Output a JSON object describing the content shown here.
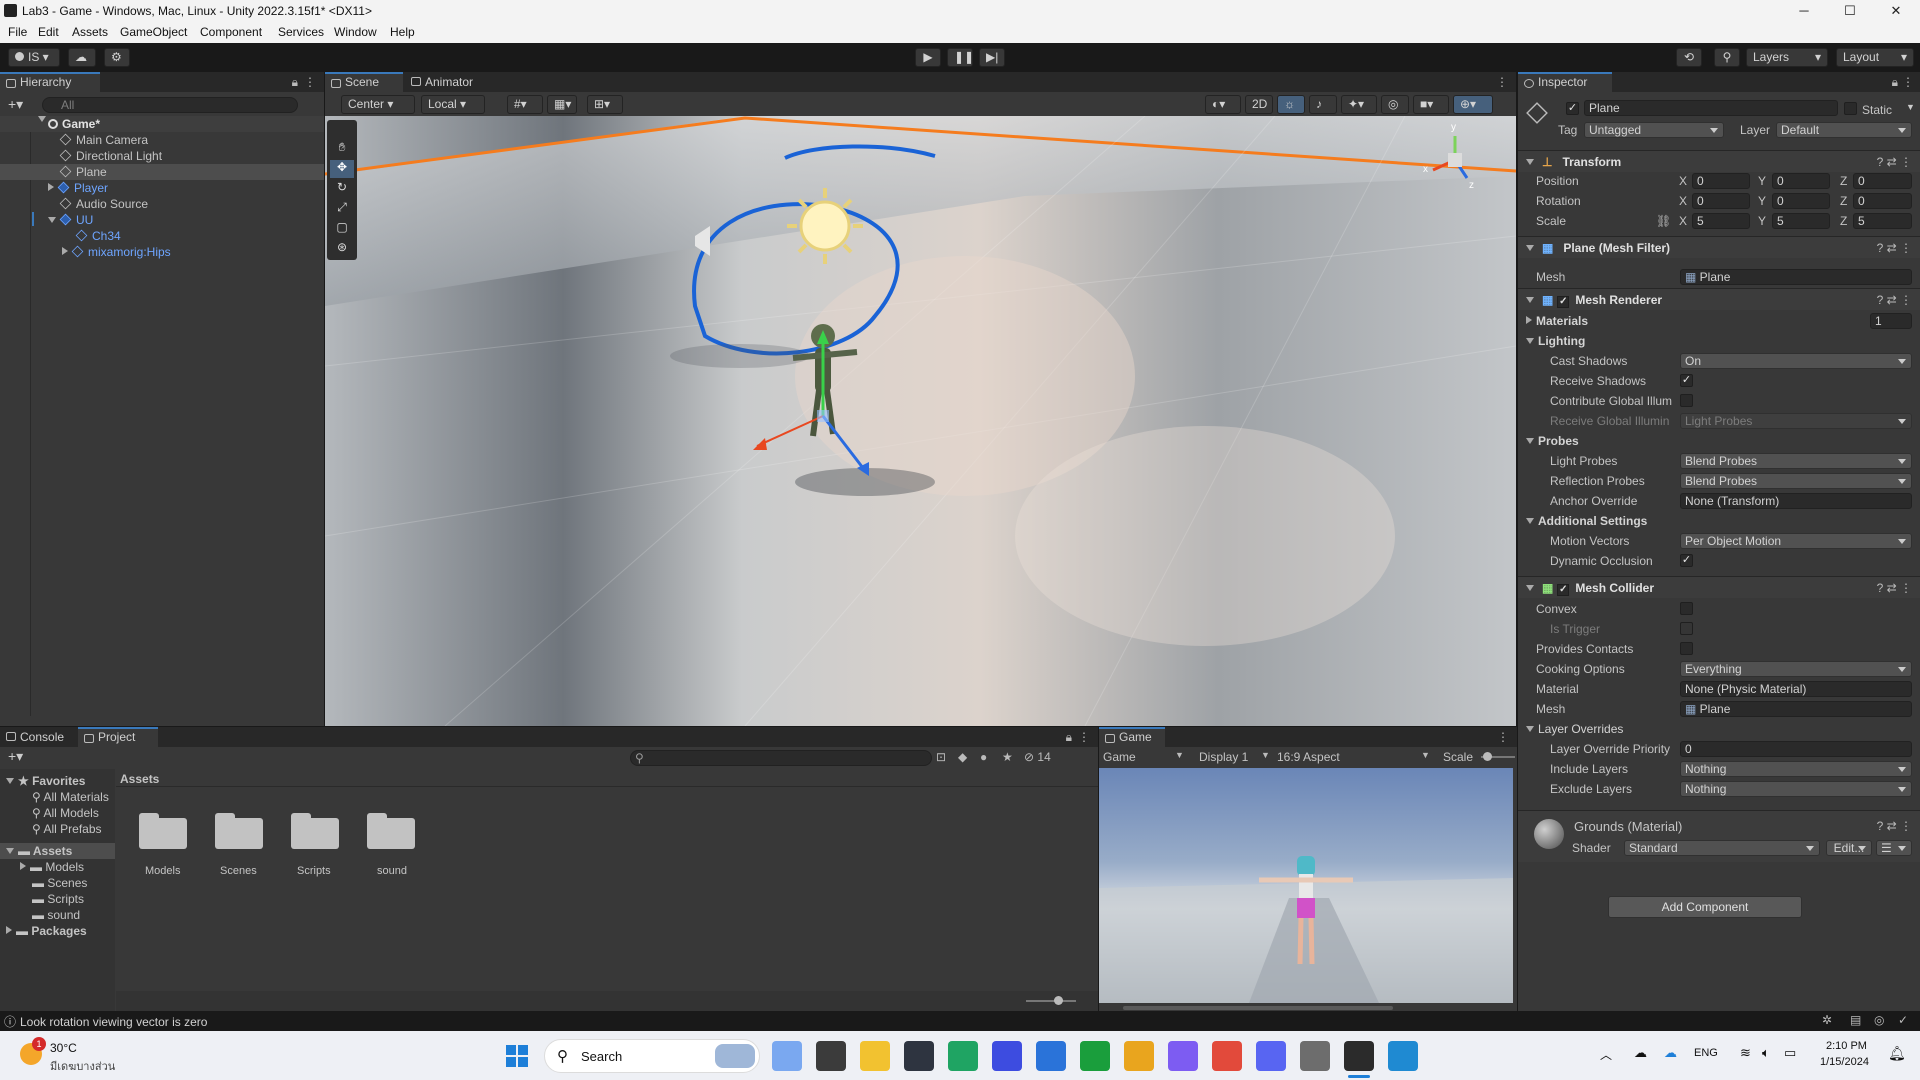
{
  "window": {
    "title": "Lab3 - Game - Windows, Mac, Linux - Unity 2022.3.15f1* <DX11>",
    "minimize": "─",
    "maximize": "☐",
    "close": "✕"
  },
  "menu": [
    "File",
    "Edit",
    "Assets",
    "GameObject",
    "Component",
    "Services",
    "Window",
    "Help"
  ],
  "toolbar": {
    "account": "IS",
    "layers": "Layers",
    "layout": "Layout"
  },
  "hierarchy": {
    "tab": "Hierarchy",
    "search_placeholder": "All",
    "items": [
      {
        "label": "Game*"
      },
      {
        "label": "Main Camera"
      },
      {
        "label": "Directional Light"
      },
      {
        "label": "Plane"
      },
      {
        "label": "Player"
      },
      {
        "label": "Audio Source"
      },
      {
        "label": "UU"
      },
      {
        "label": "Ch34"
      },
      {
        "label": "mixamorig:Hips"
      }
    ]
  },
  "scene": {
    "tabs": [
      "Scene",
      "Animator"
    ],
    "pivot": "Center",
    "space": "Local",
    "mode_2d": "2D",
    "gizmo_y": "y",
    "gizmo_x": "x",
    "gizmo_z": "z"
  },
  "inspector": {
    "tab": "Inspector",
    "object_name": "Plane",
    "static_label": "Static",
    "tag_label": "Tag",
    "tag": "Untagged",
    "layer_label": "Layer",
    "layer": "Default",
    "transform": {
      "title": "Transform",
      "position_label": "Position",
      "position": {
        "x": "0",
        "y": "0",
        "z": "0"
      },
      "rotation_label": "Rotation",
      "rotation": {
        "x": "0",
        "y": "0",
        "z": "0"
      },
      "scale_label": "Scale",
      "scale": {
        "x": "5",
        "y": "5",
        "z": "5"
      },
      "axis": {
        "x": "X",
        "y": "Y",
        "z": "Z"
      }
    },
    "mesh_filter": {
      "title": "Plane (Mesh Filter)",
      "mesh_label": "Mesh",
      "mesh": "Plane"
    },
    "mesh_renderer": {
      "title": "Mesh Renderer",
      "materials_label": "Materials",
      "materials_count": "1",
      "lighting": "Lighting",
      "cast_shadows_label": "Cast Shadows",
      "cast_shadows": "On",
      "receive_shadows_label": "Receive Shadows",
      "contribute_gi_label": "Contribute Global Illum",
      "receive_gi_label": "Receive Global Illumin",
      "receive_gi": "Light Probes",
      "probes": "Probes",
      "light_probes_label": "Light Probes",
      "light_probes": "Blend Probes",
      "reflection_probes_label": "Reflection Probes",
      "reflection_probes": "Blend Probes",
      "anchor_override_label": "Anchor Override",
      "anchor_override": "None (Transform)",
      "additional": "Additional Settings",
      "motion_vectors_label": "Motion Vectors",
      "motion_vectors": "Per Object Motion",
      "dynamic_occlusion_label": "Dynamic Occlusion"
    },
    "mesh_collider": {
      "title": "Mesh Collider",
      "convex_label": "Convex",
      "is_trigger_label": "Is Trigger",
      "provides_contacts_label": "Provides Contacts",
      "cooking_options_label": "Cooking Options",
      "cooking_options": "Everything",
      "material_label": "Material",
      "material": "None (Physic Material)",
      "mesh_label": "Mesh",
      "mesh": "Plane",
      "layer_overrides": "Layer Overrides",
      "layer_override_priority_label": "Layer Override Priority",
      "layer_override_priority": "0",
      "include_layers_label": "Include Layers",
      "include_layers": "Nothing",
      "exclude_layers_label": "Exclude Layers",
      "exclude_layers": "Nothing"
    },
    "material": {
      "title": "Grounds (Material)",
      "shader_label": "Shader",
      "shader": "Standard",
      "edit": "Edit..."
    },
    "add_component": "Add Component"
  },
  "project": {
    "tabs": [
      "Console",
      "Project"
    ],
    "hidden_count": "14",
    "breadcrumb": "Assets",
    "favorites_label": "Favorites",
    "favorites": [
      "All Materials",
      "All Models",
      "All Prefabs"
    ],
    "tree_assets": "Assets",
    "tree_children": [
      "Models",
      "Scenes",
      "Scripts",
      "sound"
    ],
    "tree_packages": "Packages",
    "folders": [
      "Models",
      "Scenes",
      "Scripts",
      "sound"
    ]
  },
  "game": {
    "tab": "Game",
    "view": "Game",
    "display": "Display 1",
    "aspect": "16:9 Aspect",
    "scale": "Scale"
  },
  "status": {
    "message": "Look rotation viewing vector is zero"
  },
  "taskbar": {
    "weather_temp": "30°C",
    "weather_desc": "มีเดฆบางส่วน",
    "badge": "1",
    "search": "Search",
    "lang": "ENG",
    "time": "2:10 PM",
    "date": "1/15/2024"
  },
  "colors": {
    "accent": "#3a79bb",
    "selection_orange": "#f57c1e",
    "panel": "#383838",
    "taskbar": "#f1f3f7"
  }
}
